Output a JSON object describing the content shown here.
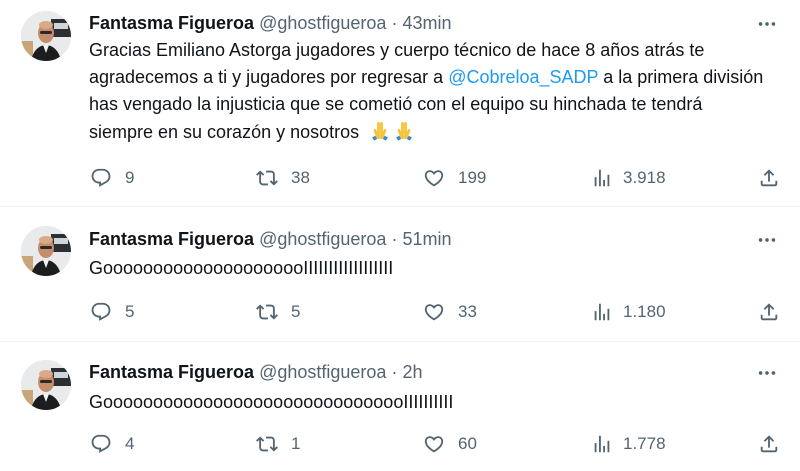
{
  "colors": {
    "text": "#0f1419",
    "muted": "#536471",
    "link": "#1d9bf0",
    "divider": "#eff3f4"
  },
  "icons": {
    "reply": "speech-bubble-icon",
    "retweet": "retweet-arrows-icon",
    "like": "heart-icon",
    "views": "bar-chart-icon",
    "share": "share-upload-icon",
    "more": "three-dots-icon",
    "emoji": "folded-hands-emoji"
  },
  "tweets": [
    {
      "author_name": "Fantasma Figueroa",
      "handle": "@ghostfigueroa",
      "separator": "·",
      "time": "43min",
      "text_before": "Gracias Emiliano Astorga jugadores y cuerpo técnico de hace 8 años atrás te agradecemos a ti y jugadores por regresar a ",
      "mention": "@Cobreloa_SADP",
      "text_after": " a la primera división has vengado la injusticia que se cometió con el equipo su hinchada te tendrá siempre en su corazón y nosotros ",
      "emoji": "🙏🙏",
      "replies": "9",
      "retweets": "38",
      "likes": "199",
      "views": "3.918"
    },
    {
      "author_name": "Fantasma Figueroa",
      "handle": "@ghostfigueroa",
      "separator": "·",
      "time": "51min",
      "text": "GooooooooooooooooooooIIIIIIIIIIIIIIIIII",
      "replies": "5",
      "retweets": "5",
      "likes": "33",
      "views": "1.180"
    },
    {
      "author_name": "Fantasma Figueroa",
      "handle": "@ghostfigueroa",
      "separator": "·",
      "time": "2h",
      "text": "GooooooooooooooooooooooooooooooIIIIIIIIII",
      "replies": "4",
      "retweets": "1",
      "likes": "60",
      "views": "1.778"
    }
  ]
}
